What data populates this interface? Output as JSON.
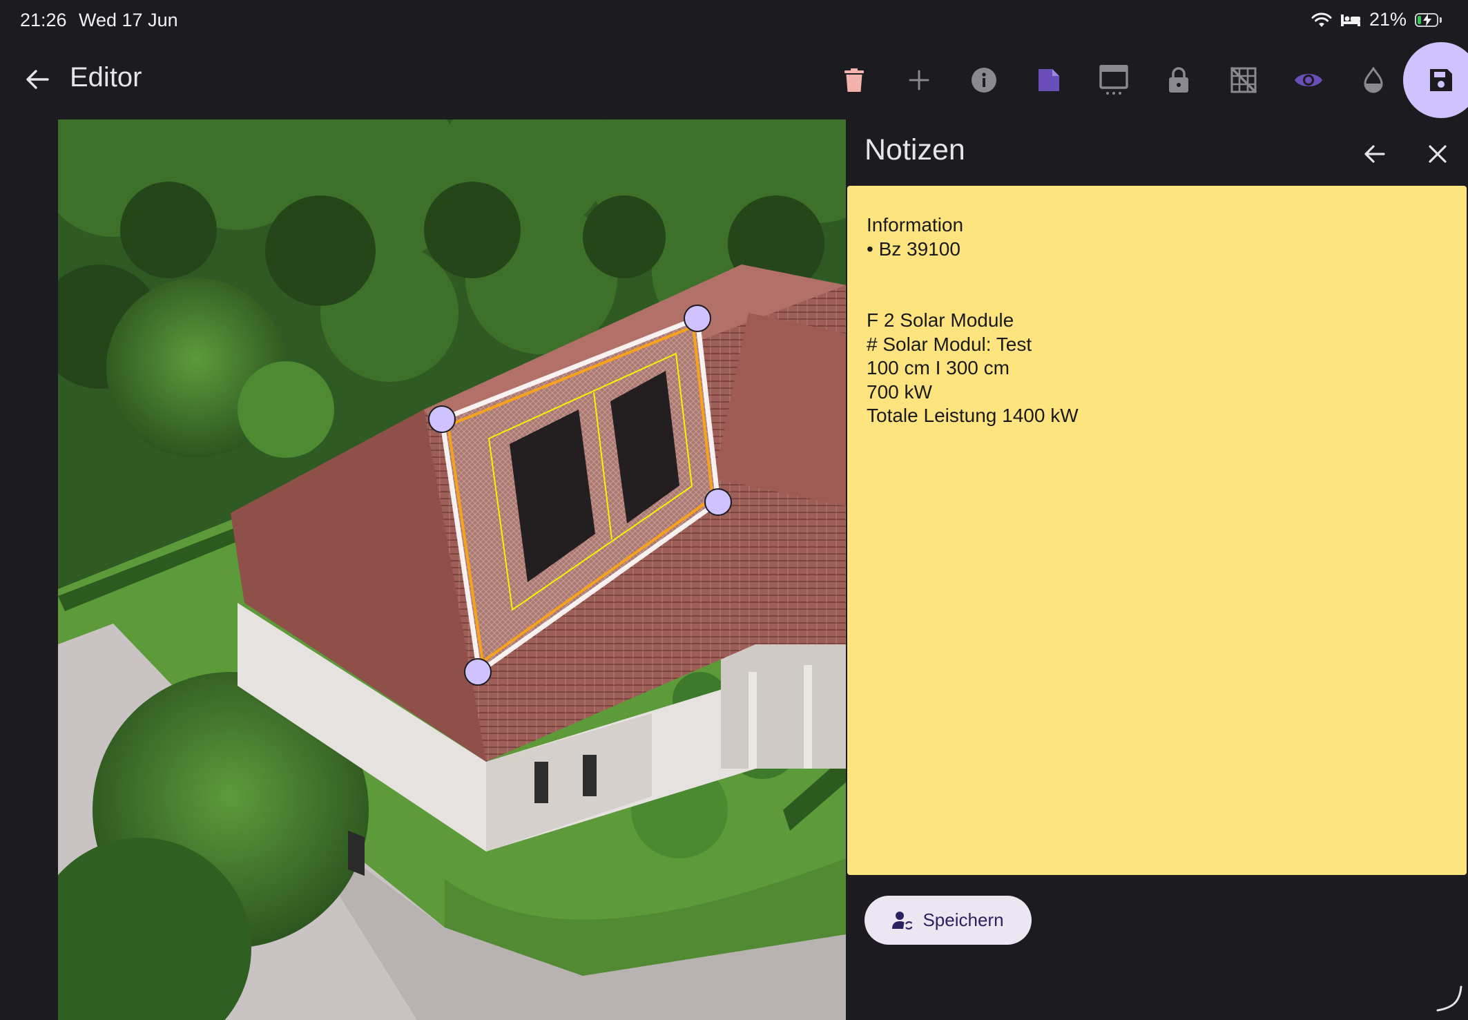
{
  "status_bar": {
    "time": "21:26",
    "date": "Wed 17 Jun",
    "battery_percent_label": "21%",
    "battery_level": 0.21,
    "icons": [
      "wifi-icon",
      "sleep-mode-icon",
      "battery-charging-icon"
    ]
  },
  "app_bar": {
    "title": "Editor",
    "back_icon": "arrow-back-icon",
    "toolbar_icons": [
      "delete-icon",
      "add-icon",
      "info-icon",
      "note-icon",
      "panel-menu-icon",
      "lock-icon",
      "grid-off-icon",
      "visibility-icon",
      "opacity-icon",
      "save-icon"
    ]
  },
  "notes": {
    "title": "Notizen",
    "lines": [
      "Information",
      "• Bz 39100",
      "",
      "",
      "F 2 Solar Module",
      "# Solar Modul: Test",
      "100 cm I 300 cm",
      "700 kW",
      "Totale Leistung 1400 kW"
    ],
    "save_label": "Speichern"
  },
  "colors": {
    "background": "#1b1b20",
    "accent": "#cfc2ff",
    "accent_dark": "#6a4fb8",
    "note_background": "#fde47e",
    "delete_icon": "#f4b2ae",
    "roof_outline": "#f7a21b",
    "module_outline": "#f5f500"
  }
}
